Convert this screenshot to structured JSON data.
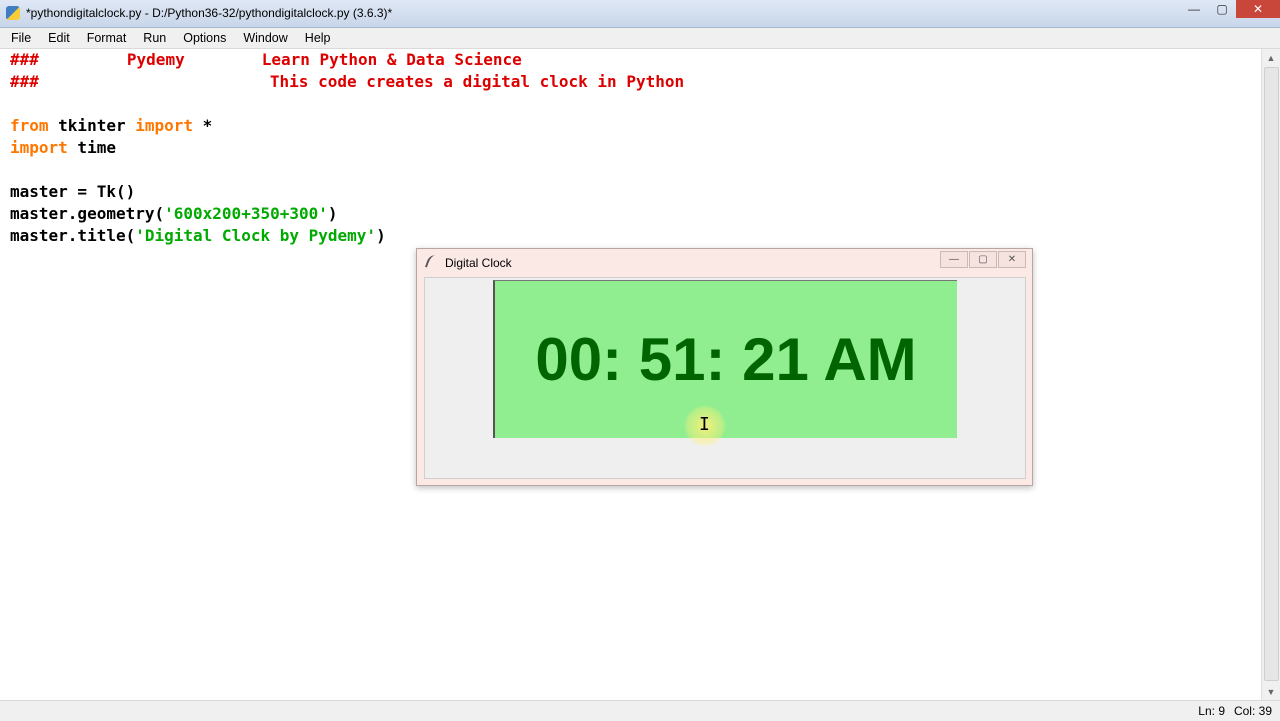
{
  "window": {
    "title": "*pythondigitalclock.py - D:/Python36-32/pythondigitalclock.py (3.6.3)*",
    "minimize": "—",
    "maximize": "▢",
    "close": "✕"
  },
  "menu": [
    "File",
    "Edit",
    "Format",
    "Run",
    "Options",
    "Window",
    "Help"
  ],
  "code": {
    "line1": {
      "hash": "###",
      "brand": "Pydemy",
      "tagline": "Learn Python & Data Science"
    },
    "line2": {
      "hash": "###",
      "desc": "This code creates a digital clock in Python"
    },
    "line4": {
      "kw1": "from",
      "mod": " tkinter ",
      "kw2": "import",
      "rest": " *"
    },
    "line5": {
      "kw": "import",
      "rest": " time"
    },
    "line7": {
      "text": "master = Tk()"
    },
    "line8": {
      "pre": "master.geometry(",
      "str": "'600x200+350+300'",
      "post": ")"
    },
    "line9": {
      "pre": "master.title(",
      "str": "'Digital Clock by Pydemy'",
      "post": ")"
    }
  },
  "status": {
    "ln": "Ln: 9",
    "col": "Col: 39"
  },
  "clock_window": {
    "title": "Digital Clock",
    "time": "00: 51: 21 AM",
    "minimize": "—",
    "maximize": "▢",
    "close": "✕"
  },
  "colors": {
    "clock_bg": "#90ee90",
    "clock_fg": "#006400",
    "comment": "#dd0000",
    "keyword": "#ff7700",
    "string": "#00aa00"
  },
  "icons": [
    "python-app-icon",
    "feather-icon",
    "ibeam-cursor-icon"
  ]
}
